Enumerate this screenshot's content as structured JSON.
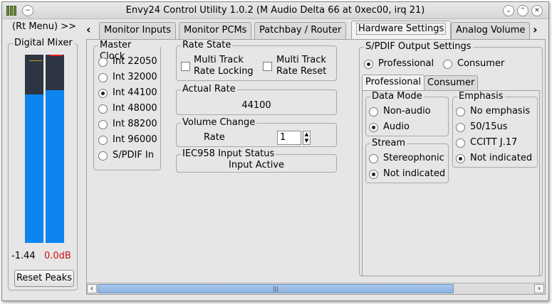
{
  "window": {
    "title": "Envy24 Control Utility 1.0.2 (M Audio Delta 66 at 0xec00, irq 21)"
  },
  "left": {
    "rt_menu": "(Rt Menu) >>",
    "mixer_label": "Digital Mixer",
    "meter_left_value": "-1.44",
    "meter_right_value": "0.0dB",
    "meter_left_level": 0.79,
    "meter_right_level": 0.81,
    "reset_label": "Reset Peaks",
    "right_value_color": "#d01010"
  },
  "tabs": [
    "Monitor Inputs",
    "Monitor PCMs",
    "Patchbay / Router",
    "Hardware Settings",
    "Analog Volume"
  ],
  "active_tab": 3,
  "master_clock": {
    "label": "Master Clock",
    "options": [
      "Int 22050",
      "Int 32000",
      "Int 44100",
      "Int 48000",
      "Int 88200",
      "Int 96000",
      "S/PDIF In"
    ],
    "selected": 2
  },
  "rate_state": {
    "label": "Rate State",
    "locking_line1": "Multi Track",
    "locking_line2": "Rate Locking",
    "reset_line1": "Multi Track",
    "reset_line2": "Rate Reset"
  },
  "actual_rate": {
    "label": "Actual Rate",
    "value": "44100"
  },
  "volume_change": {
    "label": "Volume Change",
    "rate_label": "Rate",
    "rate_value": "1"
  },
  "iec958": {
    "label": "IEC958 Input Status",
    "value": "Input Active"
  },
  "spdif": {
    "label": "S/PDIF Output Settings",
    "professional": "Professional",
    "consumer": "Consumer",
    "subtabs": [
      "Professional",
      "Consumer"
    ],
    "data_mode": {
      "label": "Data Mode",
      "options": [
        "Non-audio",
        "Audio"
      ]
    },
    "stream": {
      "label": "Stream",
      "options": [
        "Stereophonic",
        "Not indicated"
      ]
    },
    "emphasis": {
      "label": "Emphasis",
      "options": [
        "No emphasis",
        "50/15us",
        "CCITT J.17",
        "Not indicated"
      ]
    }
  }
}
